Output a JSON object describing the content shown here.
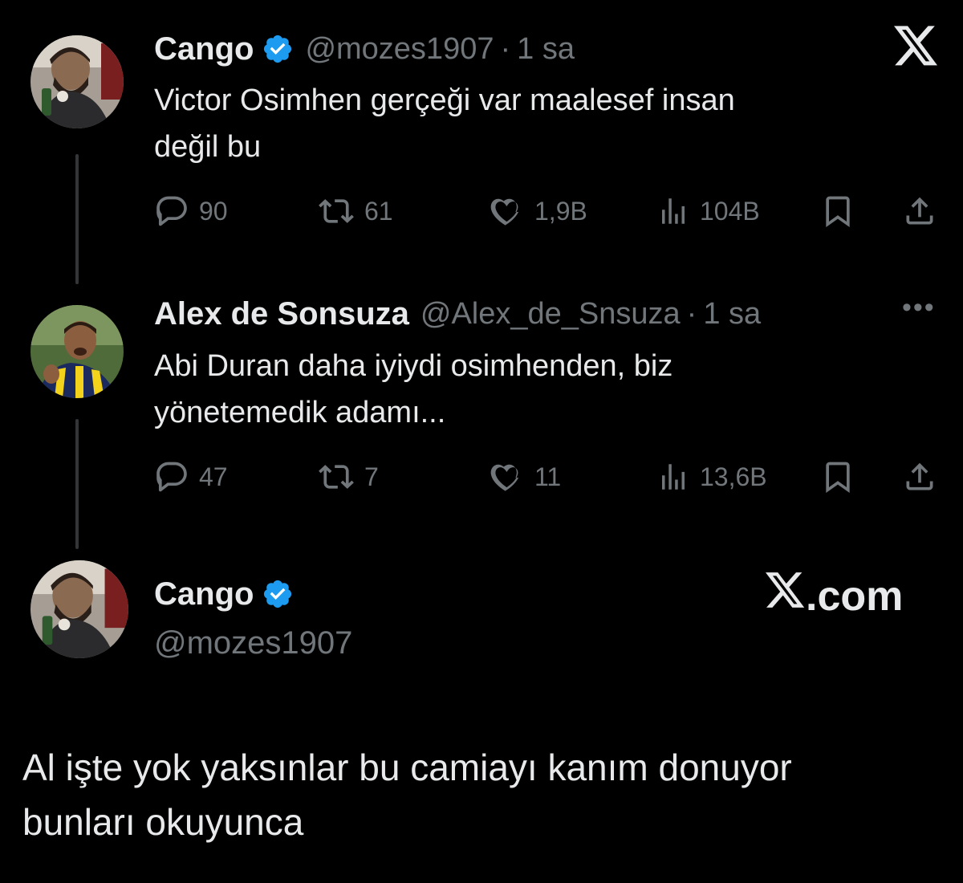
{
  "tweet1": {
    "name": "Cango",
    "handle": "@mozes1907",
    "time": "1 sa",
    "text_line1": "Victor Osimhen gerçeği var maalesef insan",
    "text_line2": "değil bu",
    "replies": "90",
    "retweets": "61",
    "likes": "1,9B",
    "views": "104B"
  },
  "tweet2": {
    "name": "Alex de Sonsuza",
    "handle": "@Alex_de_Snsuza",
    "time": "1 sa",
    "text_line1": "Abi Duran daha iyiydi osimhenden, biz",
    "text_line2": "yönetemedik adamı...",
    "replies": "47",
    "retweets": "7",
    "likes": "11",
    "views": "13,6B"
  },
  "quote_card": {
    "name": "Cango",
    "handle": "@mozes1907",
    "brand_x": "X",
    "brand_suffix": ".com"
  },
  "post": {
    "line1": "Al işte yok yaksınlar bu camiayı kanım donuyor",
    "line2": "bunları okuyunca"
  },
  "icons": {
    "reply": "reply-icon",
    "retweet": "retweet-icon",
    "like": "heart-icon",
    "views": "views-icon",
    "bookmark": "bookmark-icon",
    "share": "share-icon",
    "verified": "verified-badge-icon",
    "close": "x-logo-icon",
    "more": "more-icon"
  },
  "colors": {
    "background": "#000000",
    "text": "#e7e9ea",
    "secondary": "#71767b",
    "verified": "#1d9bf0"
  }
}
